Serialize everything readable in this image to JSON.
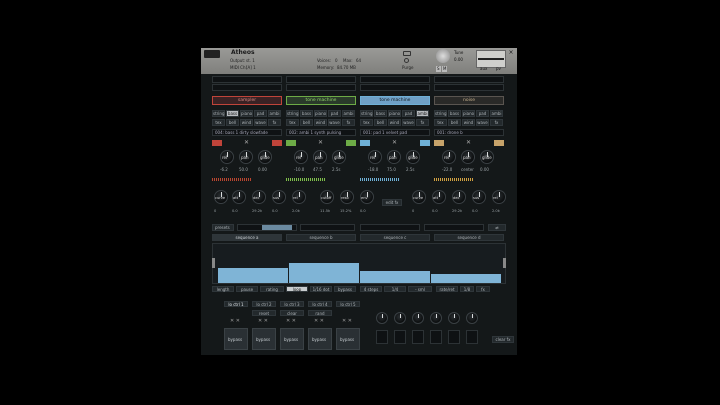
{
  "header": {
    "title": "Atheos",
    "output_label": "Output:",
    "output_value": "st. 1",
    "voices_label": "Voices:",
    "voices_value": "0",
    "max_label": "Max:",
    "max_value": "64",
    "midi_label": "MIDI Ch:",
    "midi_value": "[A] 1",
    "memory_label": "Memory:",
    "memory_value": "84.70 MB",
    "purge_label": "Purge",
    "tune_label": "Tune",
    "tune_value": "0.00",
    "s_label": "S",
    "m_label": "M",
    "aux_label": "aux",
    "pv_label": "pv"
  },
  "engines": [
    {
      "name": "sampler",
      "categories": [
        "string",
        "bass",
        "piano",
        "pad",
        "ambi"
      ],
      "categories2": [
        "tex",
        "bell",
        "wind",
        "wave",
        "fx"
      ],
      "preset": "004: bass 1 dirty slowfade",
      "rel": "rel",
      "pan": "pan",
      "glide": "glide",
      "rel_val": "-6.2",
      "pan_val": "50.0",
      "glide_val": "0.00",
      "color": "#c0443a"
    },
    {
      "name": "tone machine",
      "categories": [
        "string",
        "bass",
        "piano",
        "pad",
        "ambi"
      ],
      "categories2": [
        "tex",
        "bell",
        "wind",
        "wave",
        "fx"
      ],
      "preset": "002: ambi 1 synth pulsing",
      "rel": "rel",
      "pan": "pan",
      "glide": "glide",
      "rel_val": "-10.0",
      "pan_val": "47.5",
      "glide_val": "2.5s",
      "color": "#6dab46"
    },
    {
      "name": "tone machine",
      "categories": [
        "string",
        "bass",
        "piano",
        "pad",
        "ambi"
      ],
      "categories2": [
        "tex",
        "bell",
        "wind",
        "wave",
        "fx"
      ],
      "preset": "001: pad 1 velvet pad",
      "rel": "rel",
      "pan": "pan",
      "glide": "glide",
      "rel_val": "-18.0",
      "pan_val": "75.0",
      "glide_val": "2.5s",
      "color": "#6fb0d6"
    },
    {
      "name": "noise",
      "categories": [
        "string",
        "bass",
        "piano",
        "pad",
        "ambi"
      ],
      "categories2": [
        "tex",
        "bell",
        "wind",
        "wave",
        "fx"
      ],
      "preset": "001: drone b",
      "rel": "rel",
      "pan": "pan",
      "glide": "glide",
      "rel_val": "-22.0",
      "pan_val": "center",
      "glide_val": "0.00",
      "color": "#c7a36a"
    }
  ],
  "env_row": [
    {
      "l": "curve",
      "v": "0"
    },
    {
      "l": "att",
      "v": "0.0"
    },
    {
      "l": "dec",
      "v": "29.2k"
    },
    {
      "l": "sus",
      "v": "0.0"
    },
    {
      "l": "rel",
      "v": "2.0k"
    },
    {
      "l": "cutoff",
      "v": "11.5k"
    },
    {
      "l": "reso",
      "v": "15.2%"
    },
    {
      "l": "env",
      "v": "0.0"
    },
    {
      "l": "curve",
      "v": "0"
    },
    {
      "l": "att",
      "v": "0.0"
    },
    {
      "l": "dec",
      "v": "29.2k"
    },
    {
      "l": "sus",
      "v": "0.0"
    },
    {
      "l": "rel",
      "v": "2.0k"
    }
  ],
  "mid": {
    "edit_label": "edit fx"
  },
  "seq_toolbar": {
    "presets": "presets",
    "s1": "s1",
    "s2": "s2",
    "s3": "s3"
  },
  "sequences": [
    "sequence a",
    "sequence b",
    "sequence c",
    "sequence d"
  ],
  "seq_values": [
    0.72,
    0.92,
    0.58,
    0.4
  ],
  "seq_bottom": [
    "length",
    "pause",
    "rating",
    "loop",
    "1/16 dot",
    "bypass",
    "4 steps",
    "1/4",
    "- sml",
    "rate/ret",
    "1/8",
    "fx"
  ],
  "lower_tabs": [
    "lo ctrl 1",
    "lo ctrl 2",
    "lo ctrl 3",
    "lo ctrl 4",
    "lo ctrl 5"
  ],
  "lower_mid": [
    "reset",
    "clear",
    "rand"
  ],
  "pads": [
    "bypass",
    "bypass",
    "bypass",
    "bypass",
    "bypass"
  ],
  "footer": {
    "clear_label": "clear fx"
  }
}
